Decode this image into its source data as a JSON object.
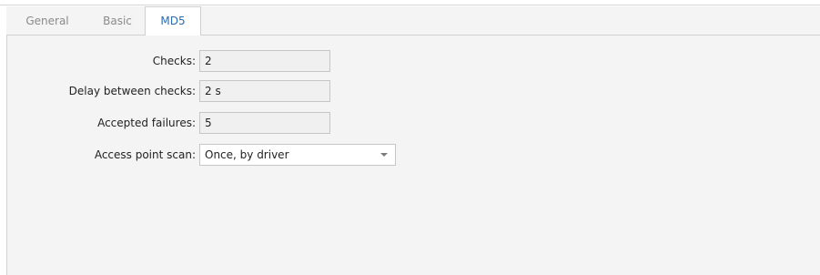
{
  "tabs": [
    {
      "label": "General"
    },
    {
      "label": "Basic"
    },
    {
      "label": "MD5"
    }
  ],
  "form": {
    "checks": {
      "label": "Checks:",
      "value": "2"
    },
    "delay": {
      "label": "Delay between checks:",
      "value": "2 s"
    },
    "failures": {
      "label": "Accepted failures:",
      "value": "5"
    },
    "scan": {
      "label": "Access point scan:",
      "value": "Once, by driver",
      "icon": "chevron-down-icon"
    }
  }
}
